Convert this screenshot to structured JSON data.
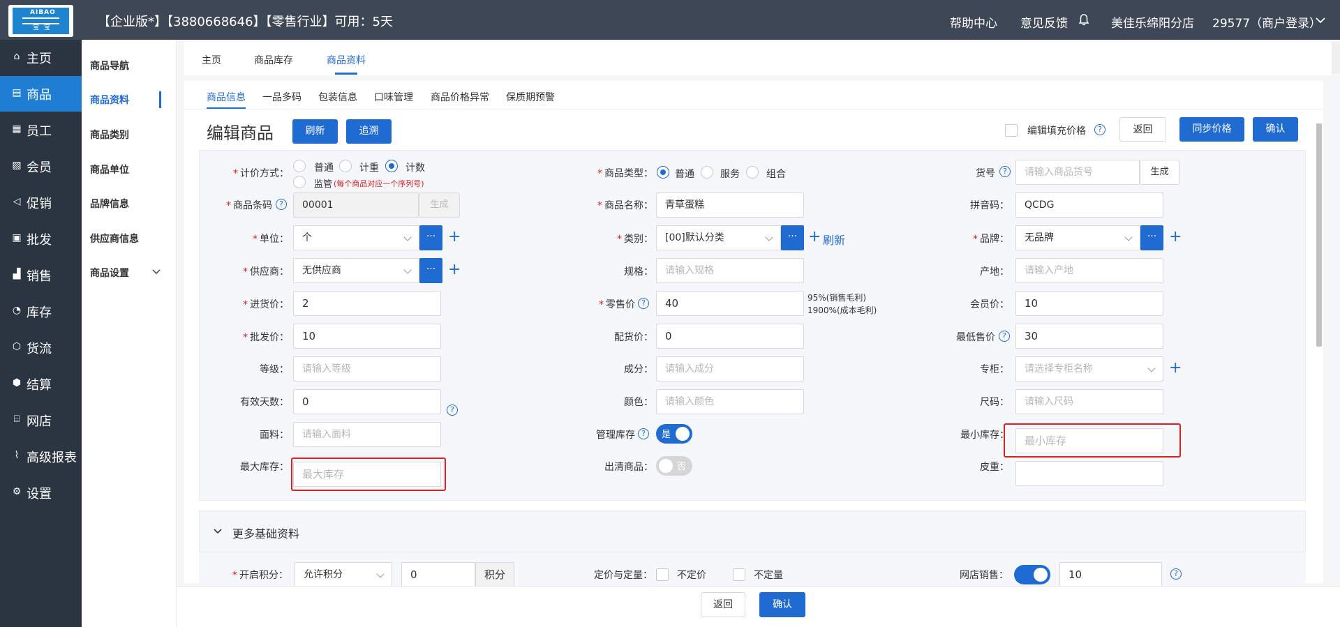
{
  "topbar": {
    "logo_text": "AIBAO",
    "logo_sub": "宝 宝",
    "title": "【企业版*】【3880668646】【零售行业】可用：5天",
    "help": "帮助中心",
    "feedback": "意见反馈",
    "store": "美佳乐绵阳分店",
    "account": "29577（商户登录）"
  },
  "sidebar": [
    {
      "label": "主页",
      "icon": "home-icon"
    },
    {
      "label": "商品",
      "icon": "goods-icon",
      "active": true
    },
    {
      "label": "员工",
      "icon": "staff-icon"
    },
    {
      "label": "会员",
      "icon": "member-icon"
    },
    {
      "label": "促销",
      "icon": "promotion-icon"
    },
    {
      "label": "批发",
      "icon": "wholesale-icon"
    },
    {
      "label": "销售",
      "icon": "sales-icon"
    },
    {
      "label": "库存",
      "icon": "inventory-icon"
    },
    {
      "label": "货流",
      "icon": "logistics-icon"
    },
    {
      "label": "结算",
      "icon": "settlement-icon"
    },
    {
      "label": "网店",
      "icon": "shop-icon"
    },
    {
      "label": "高级报表",
      "icon": "report-icon"
    },
    {
      "label": "设置",
      "icon": "settings-icon"
    }
  ],
  "subnav": [
    "商品导航",
    "商品资料",
    "商品类别",
    "商品单位",
    "品牌信息",
    "供应商信息",
    "商品设置"
  ],
  "tabs1": [
    "主页",
    "商品库存",
    "商品资料"
  ],
  "tabs2": [
    "商品信息",
    "一品多码",
    "包装信息",
    "口味管理",
    "商品价格异常",
    "保质期预警"
  ],
  "header": {
    "title": "编辑商品",
    "refresh": "刷新",
    "trace": "追溯",
    "fill_price": "编辑填充价格",
    "back": "返回",
    "sync_price": "同步价格",
    "confirm": "确认"
  },
  "form": {
    "pricing_label": "计价方式：",
    "pricing_options": [
      "普通",
      "计重",
      "计数",
      "监管"
    ],
    "pricing_note": "(每个商品对应一个序列号)",
    "type_label": "商品类型：",
    "type_options": [
      "普通",
      "服务",
      "组合"
    ],
    "sku_label": "货号",
    "sku_placeholder": "请输入商品货号",
    "generate": "生成",
    "barcode_label": "商品条码",
    "barcode_value": "00001",
    "name_label": "商品名称：",
    "name_value": "青草蛋糕",
    "pinyin_label": "拼音码：",
    "pinyin_value": "QCDG",
    "unit_label": "单位：",
    "unit_value": "个",
    "category_label": "类别：",
    "category_value": "[00]默认分类",
    "category_refresh": "刷新",
    "brand_label": "品牌：",
    "brand_value": "无品牌",
    "supplier_label": "供应商：",
    "supplier_value": "无供应商",
    "spec_label": "规格：",
    "spec_placeholder": "请输入规格",
    "origin_label": "产地：",
    "origin_placeholder": "请输入产地",
    "purchase_label": "进货价：",
    "purchase_value": "2",
    "retail_label": "零售价",
    "retail_value": "40",
    "margin1": "95%(销售毛利)",
    "margin2": "1900%(成本毛利)",
    "member_label": "会员价：",
    "member_value": "10",
    "wholesale_label": "批发价：",
    "wholesale_value": "10",
    "distribution_label": "配货价：",
    "distribution_value": "0",
    "min_price_label": "最低售价",
    "min_price_value": "30",
    "grade_label": "等级：",
    "grade_placeholder": "请输入等级",
    "ingredient_label": "成分：",
    "ingredient_placeholder": "请输入成分",
    "counter_label": "专柜：",
    "counter_placeholder": "请选择专柜名称",
    "valid_days_label": "有效天数：",
    "valid_days_value": "0",
    "color_label": "颜色：",
    "color_placeholder": "请输入颜色",
    "size_label": "尺码：",
    "size_placeholder": "请输入尺码",
    "fabric_label": "面料：",
    "fabric_placeholder": "请输入面料",
    "manage_stock_label": "管理库存",
    "manage_stock_state": "是",
    "min_stock_label": "最小库存：",
    "min_stock_placeholder": "最小库存",
    "max_stock_label": "最大库存：",
    "max_stock_placeholder": "最大库存",
    "clearance_label": "出清商品：",
    "clearance_state": "否",
    "tare_label": "皮重："
  },
  "more": {
    "title": "更多基础资料",
    "points_label": "开启积分：",
    "points_select": "允许积分",
    "points_value": "0",
    "points_unit": "积分",
    "pricing_qty_label": "定价与定量：",
    "no_price": "不定价",
    "no_qty": "不定量",
    "online_label": "网店销售：",
    "online_value": "10"
  },
  "bottom": {
    "back": "返回",
    "confirm": "确认"
  },
  "colors": {
    "primary": "#1f6bd1",
    "sidebar": "#2b3441",
    "topbar": "#3e4756",
    "required": "#e02020"
  }
}
